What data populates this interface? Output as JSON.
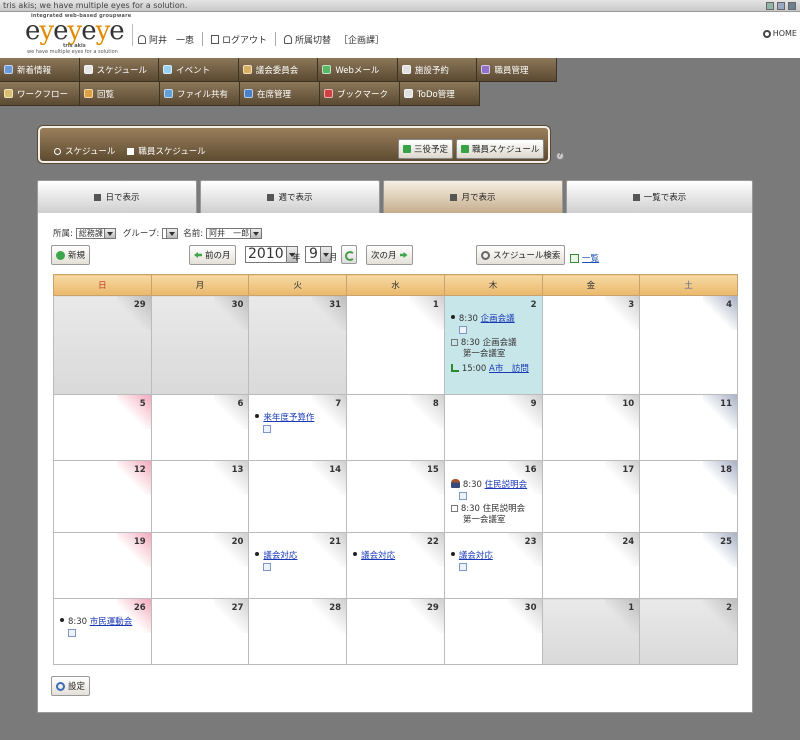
{
  "window": {
    "title": "tris akis; we have multiple eyes for a solution."
  },
  "header": {
    "logo_tagline": "integrated web-based groupware",
    "logo_wordmark": "eyeyeye",
    "logo_sub": "tris akis",
    "logo_sub2": "we have multiple eyes for a solution",
    "user_name": "阿井　一恵",
    "logout": "ログアウト",
    "switch_affiliation": "所属切替",
    "department": "［企画課］",
    "home": "HOME"
  },
  "nav": {
    "row1": [
      "新着情報",
      "スケジュール",
      "イベント",
      "議会委員会",
      "Webメール",
      "施設予約",
      "職員管理"
    ],
    "row2": [
      "ワークフロー",
      "回覧",
      "ファイル共有",
      "在席管理",
      "ブックマーク",
      "ToDo管理"
    ],
    "icon_colors": [
      "#6a9ad8",
      "#e8e8e8",
      "#9ad0f0",
      "#d8b060",
      "#58b868",
      "#e0e0e0",
      "#9070c8",
      "#d8c070",
      "#e0a040",
      "#60a0d8",
      "#4a80c8",
      "#d04040",
      "#e0e0e0"
    ]
  },
  "breadcrumb": {
    "items": [
      "スケジュール",
      "職員スケジュール"
    ],
    "btn_sanyaku": "三役予定",
    "btn_staff": "職員スケジュール",
    "help": "?"
  },
  "tabs": [
    "日で表示",
    "週で表示",
    "月で表示",
    "一覧で表示"
  ],
  "active_tab": 2,
  "filters": {
    "affiliation_label": "所属:",
    "affiliation_value": "総務課",
    "group_label": "グループ:",
    "group_value": "",
    "name_label": "名前:",
    "name_value": "阿井　一郎"
  },
  "toolbar": {
    "new": "新規",
    "prev_month": "前の月",
    "year": "2010",
    "year_unit": "年",
    "month": "9",
    "month_unit": "月",
    "next_month": "次の月",
    "search": "スケジュール検索",
    "list": "一覧",
    "settings": "設定"
  },
  "calendar": {
    "weekdays": [
      "日",
      "月",
      "火",
      "水",
      "木",
      "金",
      "土"
    ],
    "weeks": [
      [
        {
          "d": "29",
          "other": true
        },
        {
          "d": "30",
          "other": true
        },
        {
          "d": "31",
          "other": true
        },
        {
          "d": "1"
        },
        {
          "d": "2",
          "today": true,
          "events": [
            {
              "kind": "bullet",
              "time": "8:30",
              "title": "企画会議",
              "link": true,
              "mini": true
            },
            {
              "kind": "check",
              "time": "8:30",
              "title": "企画会議",
              "sub": "第一会議室"
            },
            {
              "kind": "flag",
              "time": "15:00",
              "title": "A市　訪問",
              "link": true
            }
          ]
        },
        {
          "d": "3"
        },
        {
          "d": "4"
        }
      ],
      [
        {
          "d": "5"
        },
        {
          "d": "6"
        },
        {
          "d": "7",
          "events": [
            {
              "kind": "bullet",
              "time": "",
              "title": "来年度予算作",
              "link": true,
              "mini": true
            }
          ]
        },
        {
          "d": "8"
        },
        {
          "d": "9"
        },
        {
          "d": "10"
        },
        {
          "d": "11"
        }
      ],
      [
        {
          "d": "12"
        },
        {
          "d": "13"
        },
        {
          "d": "14"
        },
        {
          "d": "15"
        },
        {
          "d": "16",
          "events": [
            {
              "kind": "person",
              "time": "8:30",
              "title": "住民説明会",
              "link": true,
              "mini": true
            },
            {
              "kind": "check",
              "time": "8:30",
              "title": "住民説明会",
              "sub": "第一会議室"
            }
          ]
        },
        {
          "d": "17"
        },
        {
          "d": "18"
        }
      ],
      [
        {
          "d": "19"
        },
        {
          "d": "20"
        },
        {
          "d": "21",
          "events": [
            {
              "kind": "bullet",
              "time": "",
              "title": "議会対応",
              "link": true,
              "mini": true
            }
          ]
        },
        {
          "d": "22",
          "events": [
            {
              "kind": "bullet",
              "time": "",
              "title": "議会対応",
              "link": true
            }
          ]
        },
        {
          "d": "23",
          "events": [
            {
              "kind": "bullet",
              "time": "",
              "title": "議会対応",
              "link": true,
              "mini": true
            }
          ]
        },
        {
          "d": "24"
        },
        {
          "d": "25"
        }
      ],
      [
        {
          "d": "26",
          "events": [
            {
              "kind": "bullet",
              "time": "8:30",
              "title": "市民運動会",
              "link": true,
              "mini": true
            }
          ]
        },
        {
          "d": "27"
        },
        {
          "d": "28"
        },
        {
          "d": "29"
        },
        {
          "d": "30"
        },
        {
          "d": "1",
          "other": true
        },
        {
          "d": "2",
          "other": true
        }
      ]
    ],
    "row_heights": [
      99,
      66,
      72,
      66,
      66
    ]
  }
}
